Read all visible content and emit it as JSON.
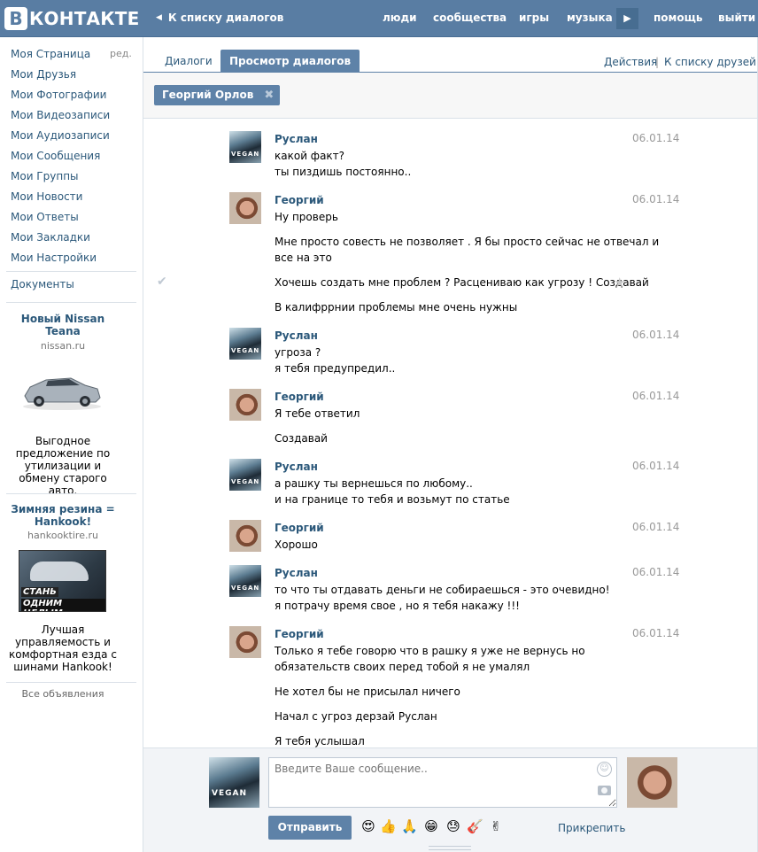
{
  "header": {
    "logo_mark": "В",
    "logo_text": "КОНТАКТЕ",
    "back_link": "К списку диалогов",
    "nav": [
      "люди",
      "сообщества",
      "игры",
      "музыка",
      "помощь",
      "выйти"
    ]
  },
  "sidebar": {
    "edit": "ред.",
    "items": [
      "Моя Страница",
      "Мои Друзья",
      "Мои Фотографии",
      "Мои Видеозаписи",
      "Мои Аудиозаписи",
      "Мои Сообщения",
      "Мои Группы",
      "Мои Новости",
      "Мои Ответы",
      "Мои Закладки",
      "Мои Настройки"
    ],
    "documents": "Документы",
    "ads": [
      {
        "title": "Новый Nissan Teana",
        "domain": "nissan.ru",
        "text": "Выгодное предложение по утилизации и обмену старого авто."
      },
      {
        "title": "Зимняя резина = Hankook!",
        "domain": "hankooktire.ru",
        "image_text_1": "СТАНЬ",
        "image_text_2": "ОДНИМ ЦЕЛЫМ",
        "text": "Лучшая управляемость и комфортная езда с шинами Hankook!"
      }
    ],
    "all_ads": "Все объявления"
  },
  "tabs": {
    "items": [
      "Диалоги",
      "Просмотр диалогов"
    ],
    "actions": "Действия",
    "separator": "|",
    "friends": "К списку друзей"
  },
  "filter": {
    "chip": "Георгий Орлов"
  },
  "messages": [
    {
      "sender": "Руслан",
      "date": "06.01.14",
      "lines": [
        "какой факт?",
        "ты пиздишь постоянно.."
      ]
    },
    {
      "sender": "Георгий",
      "date": "06.01.14",
      "lines": [
        "Ну проверь",
        "Мне просто совесть не позволяет . Я бы просто сейчас не отвечал и",
        "все на это",
        "Хочешь создать мне проблем ? Расцениваю как угрозу ! Создавай",
        "В калифррнии проблемы мне очень нужны"
      ]
    },
    {
      "sender": "Руслан",
      "date": "06.01.14",
      "lines": [
        "угроза ?",
        "я тебя предупредил.."
      ]
    },
    {
      "sender": "Георгий",
      "date": "06.01.14",
      "lines": [
        "Я тебе ответил",
        "Создавай"
      ]
    },
    {
      "sender": "Руслан",
      "date": "06.01.14",
      "lines": [
        "а рашку ты вернешься по любому..",
        "и на границе то тебя и возьмут по статье"
      ]
    },
    {
      "sender": "Георгий",
      "date": "06.01.14",
      "lines": [
        "Хорошо"
      ]
    },
    {
      "sender": "Руслан",
      "date": "06.01.14",
      "lines": [
        "то что ты отдавать деньги не собираешься - это очевидно!",
        "я потрачу время свое , но я тебя накажу !!!"
      ]
    },
    {
      "sender": "Георгий",
      "date": "06.01.14",
      "lines": [
        "Только я тебе говорю что в рашку я уже не вернусь но",
        "обязательств своих перед тобой я не умалял",
        "Не хотел бы не присылал ничего",
        "Начал с угроз дерзай Руслан",
        "Я тебя услышал"
      ]
    }
  ],
  "avatar_text": "VEGAN",
  "composer": {
    "placeholder": "Введите Ваше сообщение..",
    "send": "Отправить",
    "attach": "Прикрепить",
    "emojis": [
      "😍",
      "👍",
      "🙏",
      "😁",
      "😓",
      "🎸",
      "✌"
    ]
  }
}
